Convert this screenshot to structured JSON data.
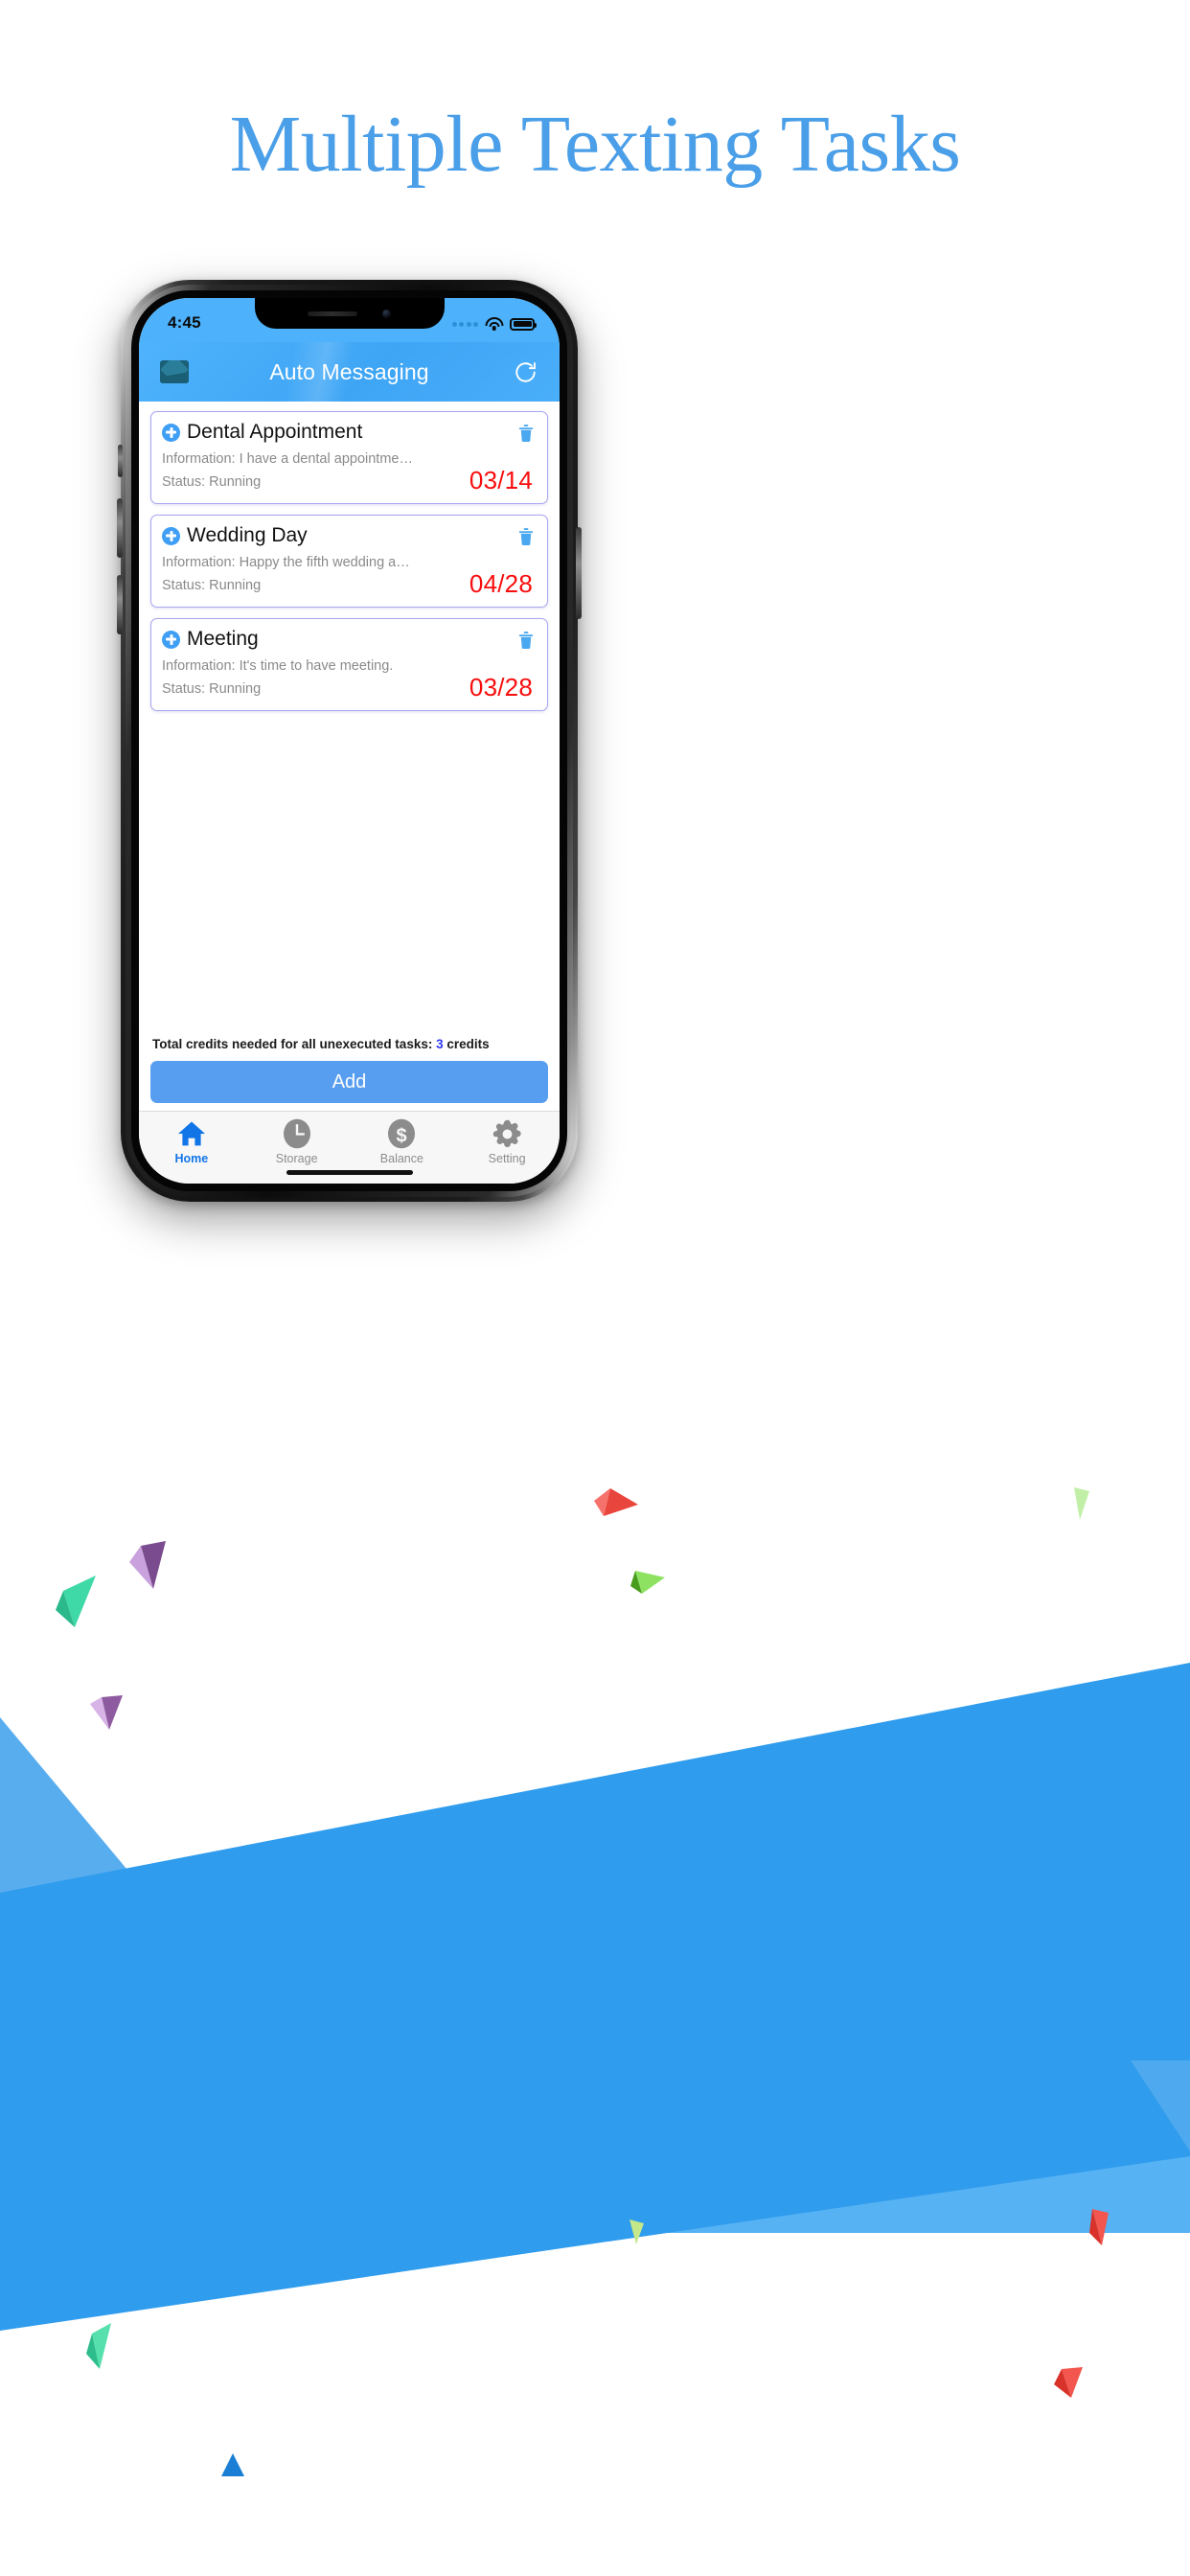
{
  "page": {
    "headline": "Multiple Texting Tasks",
    "accent_blue": "#4a9fe8"
  },
  "phone": {
    "status_bar": {
      "time": "4:45",
      "wifi_icon": "wifi-icon",
      "battery_icon": "battery-full-icon",
      "signal_icon": "signal-dots-icon"
    },
    "nav_bar": {
      "mail_icon": "mail-envelope-icon",
      "title": "Auto Messaging",
      "refresh_icon": "refresh-icon"
    },
    "tasks": [
      {
        "add_icon": "plus-circle-icon",
        "title": "Dental Appointment",
        "information": "Information: I have a dental appointme…",
        "status": "Status: Running",
        "date": "03/14",
        "delete_icon": "trash-icon"
      },
      {
        "add_icon": "plus-circle-icon",
        "title": "Wedding Day",
        "information": "Information: Happy the fifth wedding a…",
        "status": "Status: Running",
        "date": "04/28",
        "delete_icon": "trash-icon"
      },
      {
        "add_icon": "plus-circle-icon",
        "title": "Meeting",
        "information": "Information: It's time to have meeting.",
        "status": "Status: Running",
        "date": "03/28",
        "delete_icon": "trash-icon"
      }
    ],
    "footer": {
      "credits_prefix": "Total credits needed for all unexecuted tasks: ",
      "credits_count": "3",
      "credits_suffix": " credits",
      "add_button": "Add"
    },
    "tab_bar": [
      {
        "label": "Home",
        "icon": "home-icon",
        "active": true
      },
      {
        "label": "Storage",
        "icon": "clock-icon",
        "active": false
      },
      {
        "label": "Balance",
        "icon": "dollar-icon",
        "active": false
      },
      {
        "label": "Setting",
        "icon": "gear-icon",
        "active": false
      }
    ]
  },
  "colors": {
    "status_blue": "#4db2fb",
    "nav_blue": "#4aaefa",
    "date_red": "#f90d0d",
    "credit_blue": "#2d37f0",
    "add_button_blue": "#589ef0",
    "tab_active_blue": "#1175e8",
    "tab_inactive_gray": "#8c8c8c",
    "card_border": "#a9a6f0",
    "band_blue": "#2f9ced"
  }
}
